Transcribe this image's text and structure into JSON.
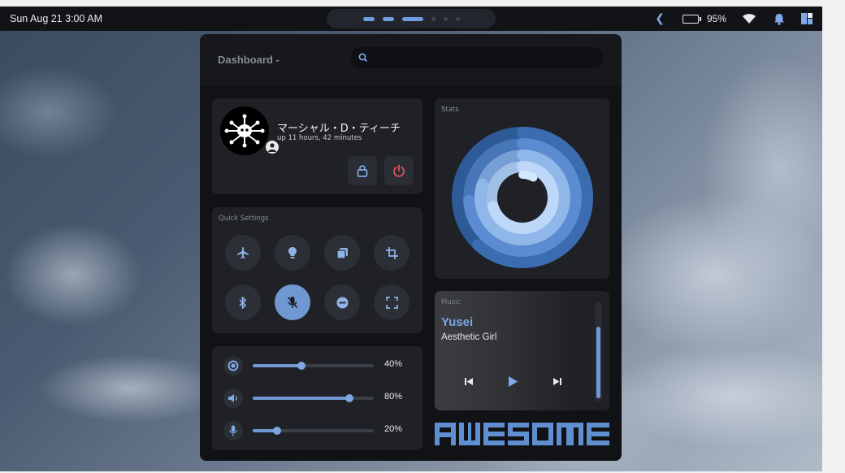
{
  "topbar": {
    "datetime": "Sun Aug 21  3:00 AM",
    "battery_percent": "95%",
    "battery_level": 0.95,
    "workspaces": [
      "active",
      "active",
      "current",
      "empty",
      "empty",
      "empty"
    ]
  },
  "dashboard": {
    "title": "Dashboard -",
    "search_placeholder": ""
  },
  "profile": {
    "name": "マーシャル・D・ティーチ",
    "uptime": "up 11 hours, 42 minutes",
    "icons": [
      "lock-icon",
      "power-icon"
    ]
  },
  "quick_settings": {
    "label": "Quick Settings",
    "buttons": [
      {
        "name": "airplane-mode",
        "icon": "airplane-icon",
        "on": false
      },
      {
        "name": "night-light",
        "icon": "lightbulb-icon",
        "on": false
      },
      {
        "name": "window-switcher",
        "icon": "copy-icon",
        "on": false
      },
      {
        "name": "screenshot-crop",
        "icon": "crop-icon",
        "on": false
      },
      {
        "name": "bluetooth",
        "icon": "bluetooth-icon",
        "on": false
      },
      {
        "name": "microphone-mute",
        "icon": "mic-off-icon",
        "on": true
      },
      {
        "name": "do-not-disturb",
        "icon": "minus-circle-icon",
        "on": false
      },
      {
        "name": "fullscreen",
        "icon": "fullscreen-icon",
        "on": false
      }
    ]
  },
  "sliders": [
    {
      "name": "brightness",
      "icon": "brightness-icon",
      "value": 40,
      "label": "40%"
    },
    {
      "name": "volume",
      "icon": "volume-icon",
      "value": 80,
      "label": "80%"
    },
    {
      "name": "microphone",
      "icon": "mic-icon",
      "value": 20,
      "label": "20%"
    }
  ],
  "stats": {
    "label": "Stats",
    "rings": [
      {
        "color": "#2f5f9e",
        "fraction": 0.62
      },
      {
        "color": "#4a7cc0",
        "fraction": 0.74
      },
      {
        "color": "#7aa6de",
        "fraction": 0.8
      },
      {
        "color": "#a9c9f0",
        "fraction": 0.7
      },
      {
        "color": "#b7d6ff",
        "fraction": 0.08
      }
    ]
  },
  "music": {
    "label": "Music",
    "title": "Yusei",
    "artist": "Aesthetic Girl",
    "controls": [
      "previous-icon",
      "play-icon",
      "next-icon"
    ]
  },
  "logo": {
    "text": "AWESOME"
  },
  "colors": {
    "accent": "#6f98d2",
    "power": "#e0525a",
    "battery": "#5fc27a"
  }
}
